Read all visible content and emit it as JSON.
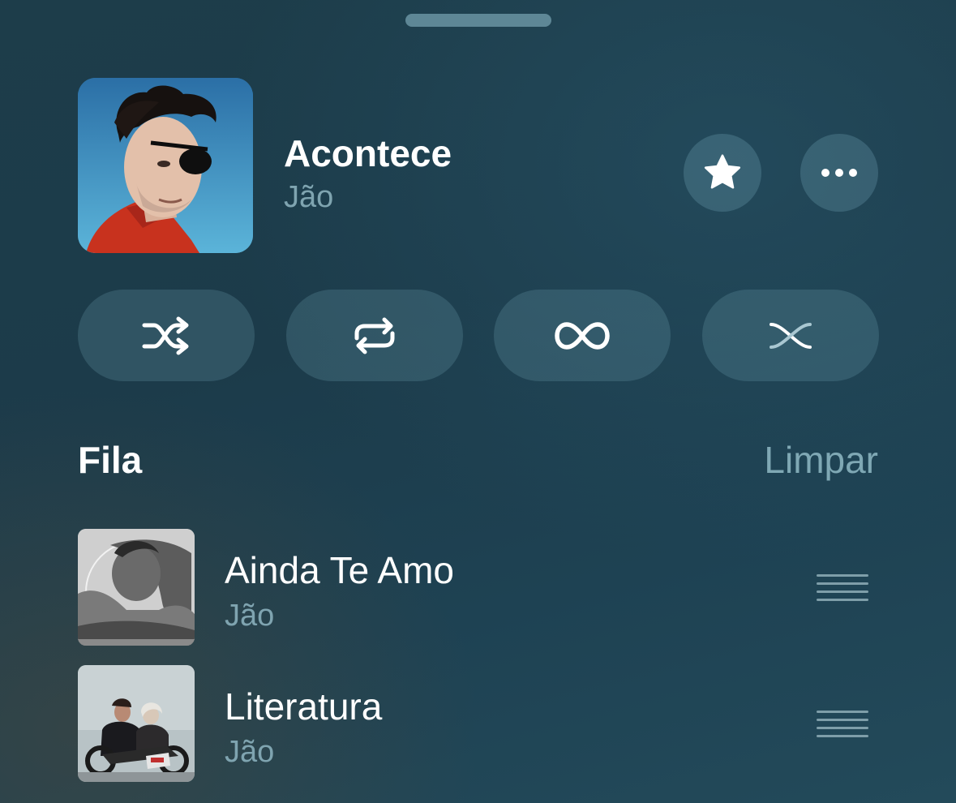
{
  "now_playing": {
    "title": "Acontece",
    "artist": "Jão",
    "favorite_icon": "star-icon",
    "more_icon": "ellipsis-icon"
  },
  "playback_modes": [
    {
      "name": "shuffle",
      "icon": "shuffle-icon"
    },
    {
      "name": "repeat",
      "icon": "repeat-icon"
    },
    {
      "name": "infinity",
      "icon": "infinity-icon"
    },
    {
      "name": "crossfade",
      "icon": "crossfade-icon"
    }
  ],
  "queue": {
    "title": "Fila",
    "clear_label": "Limpar",
    "items": [
      {
        "title": "Ainda Te Amo",
        "artist": "Jão"
      },
      {
        "title": "Literatura",
        "artist": "Jão"
      }
    ]
  },
  "colors": {
    "background": "#1d3d4a",
    "secondary_text": "#7fa4b0",
    "button_fill": "#3a5f6c"
  }
}
